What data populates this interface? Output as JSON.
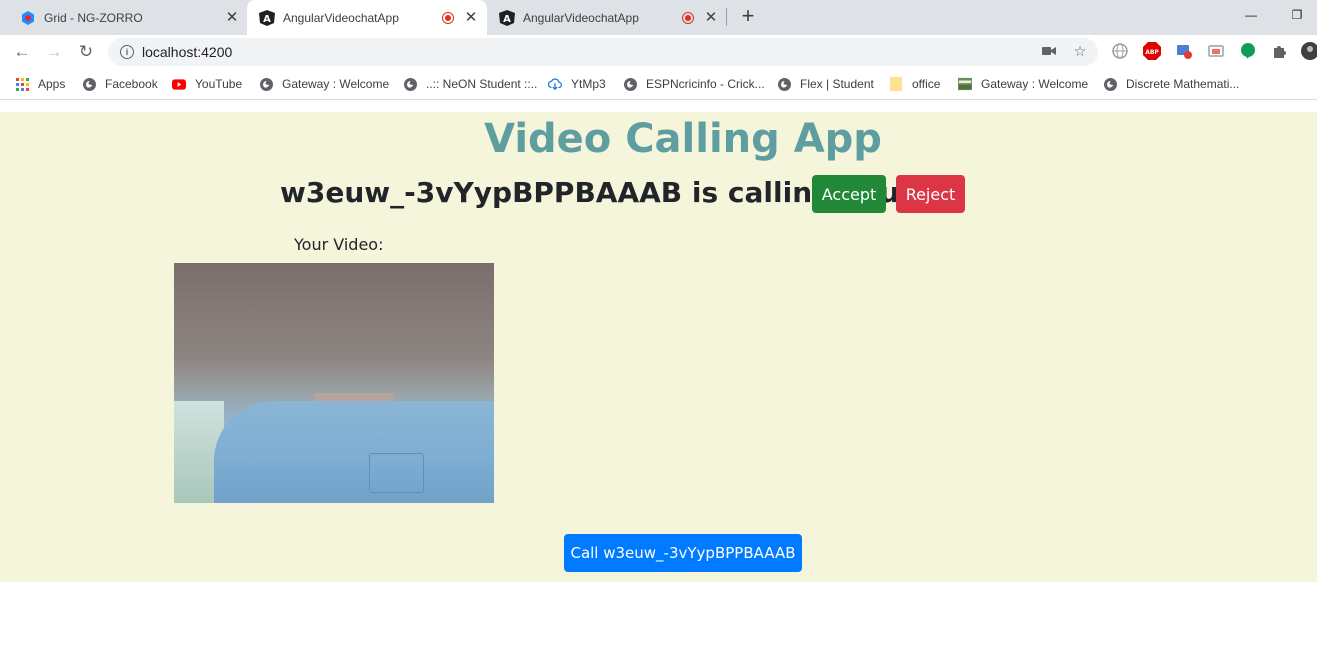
{
  "tabs": [
    {
      "title": "Grid - NG-ZORRO",
      "icon": "ng-zorro-icon",
      "recording": false,
      "active": false
    },
    {
      "title": "AngularVideochatApp",
      "icon": "angular-icon",
      "recording": true,
      "active": true
    },
    {
      "title": "AngularVideochatApp",
      "icon": "angular-icon",
      "recording": true,
      "active": false
    }
  ],
  "toolbar": {
    "url": "localhost:4200"
  },
  "bookmarks": [
    {
      "label": "Apps",
      "icon": "apps-grid-icon"
    },
    {
      "label": "Facebook",
      "icon": "globe-icon"
    },
    {
      "label": "YouTube",
      "icon": "youtube-icon"
    },
    {
      "label": "Gateway : Welcome",
      "icon": "globe-icon"
    },
    {
      "label": "..:: NeON Student ::..",
      "icon": "globe-icon"
    },
    {
      "label": "YtMp3",
      "icon": "download-cloud-icon"
    },
    {
      "label": "ESPNcricinfo - Crick...",
      "icon": "globe-icon"
    },
    {
      "label": "Flex | Student",
      "icon": "globe-icon"
    },
    {
      "label": "office",
      "icon": "folder-icon"
    },
    {
      "label": "Gateway : Welcome",
      "icon": "site-icon"
    },
    {
      "label": "Discrete Mathemati...",
      "icon": "globe-icon"
    }
  ],
  "app": {
    "title": "Video Calling App",
    "incoming_call_text": "w3euw_-3vYypBPPBAAAB is calling you",
    "accept_label": "Accept",
    "reject_label": "Reject",
    "your_video_label": "Your Video:",
    "call_button_label": "Call w3euw_-3vYypBPPBAAAB"
  },
  "colors": {
    "page_background": "#f5f5dc",
    "title_color": "#5f9ea0",
    "accept": "#218838",
    "reject": "#dc3545",
    "call": "#007bff"
  }
}
